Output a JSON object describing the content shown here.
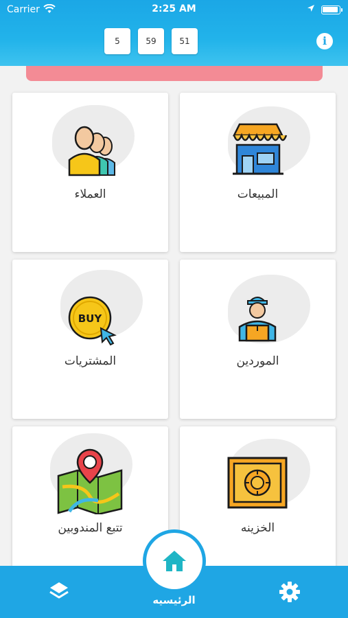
{
  "status_bar": {
    "carrier": "Carrier",
    "time": "2:25 AM"
  },
  "header": {
    "timer": [
      "5",
      "59",
      "51"
    ],
    "info_icon": "info-icon"
  },
  "cards": [
    {
      "label": "المبيعات",
      "icon": "shop-icon"
    },
    {
      "label": "العملاء",
      "icon": "customers-icon"
    },
    {
      "label": "الموردين",
      "icon": "supplier-icon"
    },
    {
      "label": "المشتريات",
      "icon": "buy-icon"
    },
    {
      "label": "الخزينه",
      "icon": "safe-icon"
    },
    {
      "label": "تتبع المندوبين",
      "icon": "map-pin-icon"
    }
  ],
  "bottom_nav": {
    "home_label": "الرئيسيه",
    "left_icon": "layers-icon",
    "right_icon": "gear-icon",
    "home_icon": "home-icon"
  },
  "colors": {
    "primary": "#1fa6e4",
    "banner": "#f38b95"
  }
}
